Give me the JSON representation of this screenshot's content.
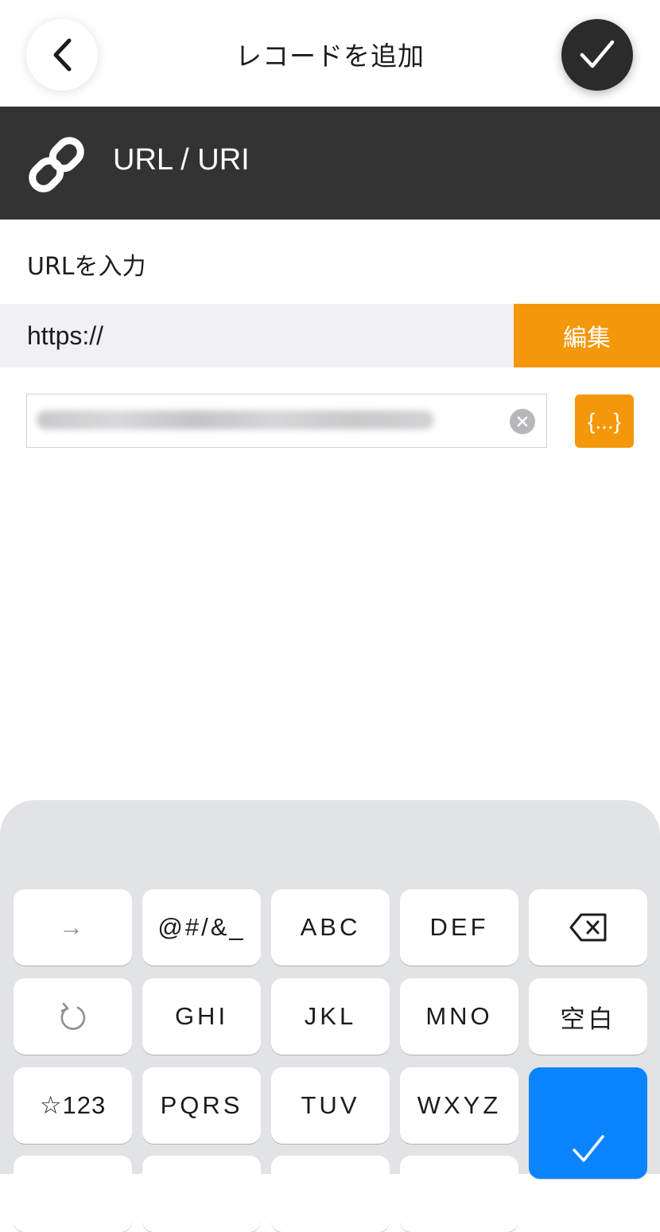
{
  "header": {
    "title": "レコードを追加",
    "back_icon": "chevron-left-icon",
    "done_icon": "checkmark-icon"
  },
  "banner": {
    "icon": "link-icon",
    "label": "URL / URI"
  },
  "form": {
    "prompt": "URLを入力",
    "scheme": "https://",
    "edit_label": "編集",
    "variable_label": "{...}",
    "url_value_redacted": true
  },
  "keyboard": {
    "rows": [
      [
        "→",
        "@#/&_",
        "ABC",
        "DEF",
        "⌫"
      ],
      [
        "↺",
        "GHI",
        "JKL",
        "MNO",
        "空白"
      ],
      [
        "☆123",
        "PQRS",
        "TUV",
        "WXYZ",
        "✓"
      ]
    ],
    "enter_color": "#0a84ff"
  },
  "colors": {
    "accent": "#f5970a",
    "banner": "#333333",
    "done_button": "#2b2b2b"
  }
}
